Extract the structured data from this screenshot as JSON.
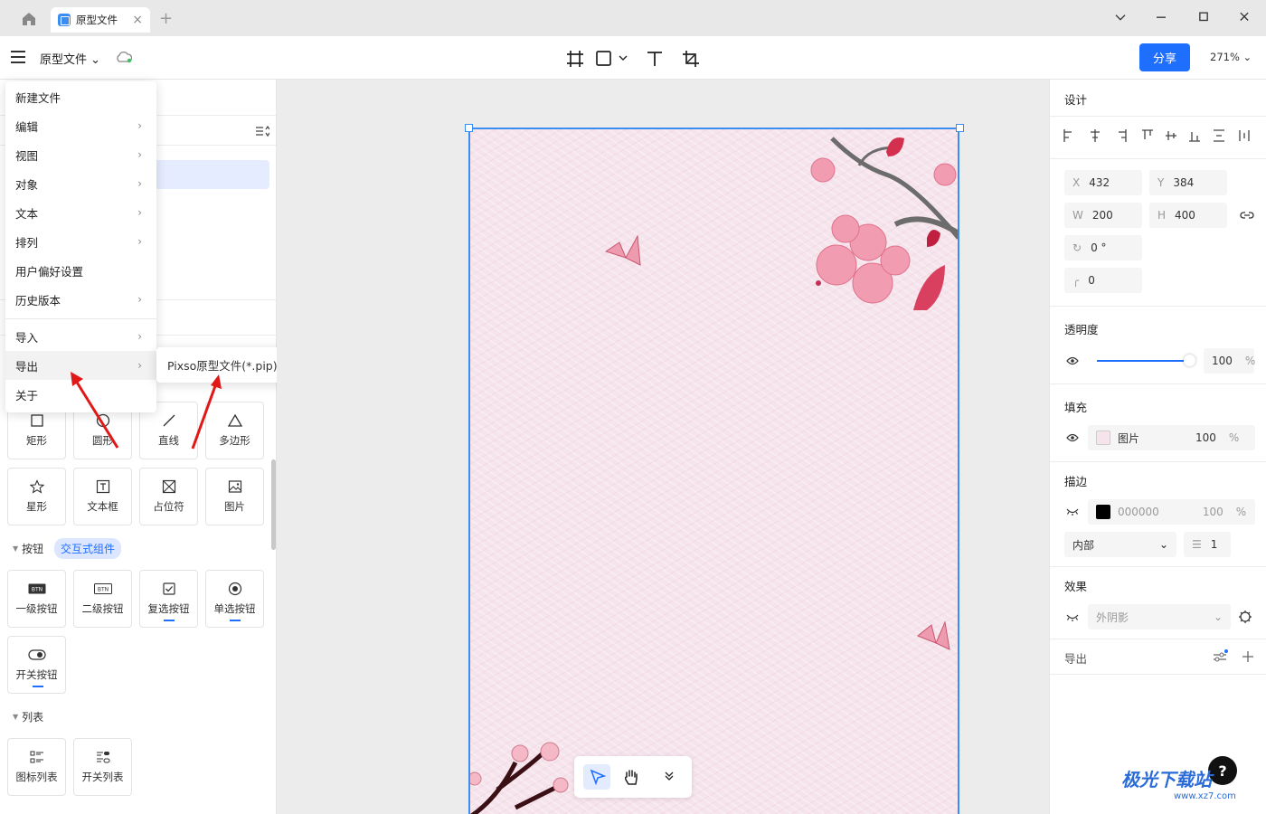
{
  "titlebar": {
    "tab_label": "原型文件",
    "tab_close": "×",
    "tab_add": "+",
    "window_controls": [
      "chevron-down-icon",
      "minimize-icon",
      "maximize-icon",
      "close-icon"
    ]
  },
  "toolbar": {
    "file_name": "原型文件",
    "share_label": "分享",
    "zoom": "271%",
    "tools": [
      "frame-tool-icon",
      "rectangle-tool-icon",
      "text-tool-icon",
      "crop-tool-icon"
    ]
  },
  "menu": {
    "items": [
      {
        "label": "新建文件",
        "submenu": false
      },
      {
        "label": "编辑",
        "submenu": true
      },
      {
        "label": "视图",
        "submenu": true
      },
      {
        "label": "对象",
        "submenu": true
      },
      {
        "label": "文本",
        "submenu": true
      },
      {
        "label": "排列",
        "submenu": true
      },
      {
        "label": "用户偏好设置",
        "submenu": false
      },
      {
        "label": "历史版本",
        "submenu": true
      },
      {
        "label": "导入",
        "submenu": true
      },
      {
        "label": "导出",
        "submenu": true,
        "highlighted": true
      },
      {
        "label": "关于",
        "submenu": false
      }
    ],
    "export_submenu_item": "Pixso原型文件(*.pip)"
  },
  "left_panel": {
    "shapes": [
      "矩形",
      "圆形",
      "直线",
      "多边形",
      "星形",
      "文本框",
      "占位符",
      "图片"
    ],
    "section_button": "按钮",
    "section_badge": "交互式组件",
    "buttons": [
      "一级按钮",
      "二级按钮",
      "复选按钮",
      "单选按钮",
      "开关按钮"
    ],
    "section_list": "列表",
    "lists": [
      "图标列表",
      "开关列表"
    ],
    "btn_icon_text": "BTN"
  },
  "right_panel": {
    "design_title": "设计",
    "x_label": "X",
    "x_value": "432",
    "y_label": "Y",
    "y_value": "384",
    "w_label": "W",
    "w_value": "200",
    "h_label": "H",
    "h_value": "400",
    "rotation": "0 °",
    "radius": "0",
    "opacity_title": "透明度",
    "opacity_value": "100",
    "opacity_unit": "%",
    "opacity_level": 1.0,
    "fill_title": "填充",
    "fill_type": "图片",
    "fill_opacity": "100",
    "fill_unit": "%",
    "stroke_title": "描边",
    "stroke_color_hex": "000000",
    "stroke_opacity": "100",
    "stroke_unit": "%",
    "stroke_position": "内部",
    "stroke_width": "1",
    "effect_title": "效果",
    "effect_type": "外阴影",
    "export_title": "导出"
  },
  "help": "?",
  "watermark": {
    "brand": "极光下载站",
    "url": "www.xz7.com"
  },
  "colors": {
    "accent": "#1f6fff",
    "selection": "#3b8df2",
    "frame_bg": "#f6e4ec",
    "blossom": "#e86a86",
    "arrow": "#e01818"
  }
}
